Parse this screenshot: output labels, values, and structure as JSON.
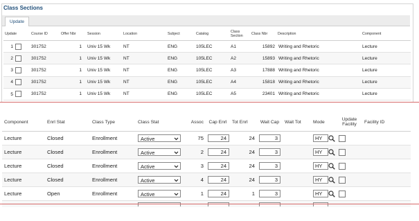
{
  "title": "Class Sections",
  "tab_label": "Update",
  "top_table": {
    "headers": [
      "Update",
      "Course ID",
      "Offer Nbr",
      "Session",
      "Location",
      "Subject",
      "Catalog",
      "Class Section",
      "Class Nbr",
      "Description",
      "Component"
    ],
    "rows": [
      {
        "n": "1",
        "course_id": "301752",
        "offer": "1",
        "session": "Univ 15 Wk",
        "location": "NT",
        "subject": "ENG",
        "catalog": "105LEC",
        "section": "A1",
        "class_nbr": "15892",
        "description": "Writing and Rhetoric",
        "component": "Lecture"
      },
      {
        "n": "2",
        "course_id": "301752",
        "offer": "1",
        "session": "Univ 15 Wk",
        "location": "NT",
        "subject": "ENG",
        "catalog": "105LEC",
        "section": "A2",
        "class_nbr": "15893",
        "description": "Writing and Rhetoric",
        "component": "Lecture"
      },
      {
        "n": "3",
        "course_id": "301752",
        "offer": "1",
        "session": "Univ 15 Wk",
        "location": "NT",
        "subject": "ENG",
        "catalog": "105LEC",
        "section": "A3",
        "class_nbr": "17888",
        "description": "Writing and Rhetoric",
        "component": "Lecture"
      },
      {
        "n": "4",
        "course_id": "301752",
        "offer": "1",
        "session": "Univ 15 Wk",
        "location": "NT",
        "subject": "ENG",
        "catalog": "105LEC",
        "section": "A4",
        "class_nbr": "15818",
        "description": "Writing and Rhetoric",
        "component": "Lecture"
      },
      {
        "n": "5",
        "course_id": "301752",
        "offer": "1",
        "session": "Univ 15 Wk",
        "location": "NT",
        "subject": "ENG",
        "catalog": "105LEC",
        "section": "A5",
        "class_nbr": "23401",
        "description": "Writing and Rhetoric",
        "component": "Lecture"
      }
    ]
  },
  "bottom_table": {
    "headers": [
      "Component",
      "Enrl Stat",
      "Class Type",
      "Class Stat",
      "Assoc",
      "Cap Enrl",
      "Tot Enrl",
      "Wait Cap",
      "Wait Tot",
      "Mode",
      "Update Facility",
      "Facility ID"
    ],
    "rows": [
      {
        "component": "Lecture",
        "enrl_stat": "Closed",
        "class_type": "Enrollment",
        "class_stat": "Active",
        "assoc": "75",
        "cap_enrl": "24",
        "tot_enrl": "24",
        "wait_cap": "3",
        "wait_tot": "",
        "mode": "HY",
        "facility_id": ""
      },
      {
        "component": "Lecture",
        "enrl_stat": "Closed",
        "class_type": "Enrollment",
        "class_stat": "Active",
        "assoc": "2",
        "cap_enrl": "24",
        "tot_enrl": "24",
        "wait_cap": "3",
        "wait_tot": "",
        "mode": "HY",
        "facility_id": ""
      },
      {
        "component": "Lecture",
        "enrl_stat": "Closed",
        "class_type": "Enrollment",
        "class_stat": "Active",
        "assoc": "3",
        "cap_enrl": "24",
        "tot_enrl": "24",
        "wait_cap": "3",
        "wait_tot": "",
        "mode": "HY",
        "facility_id": ""
      },
      {
        "component": "Lecture",
        "enrl_stat": "Closed",
        "class_type": "Enrollment",
        "class_stat": "Active",
        "assoc": "4",
        "cap_enrl": "24",
        "tot_enrl": "24",
        "wait_cap": "3",
        "wait_tot": "",
        "mode": "HY",
        "facility_id": ""
      },
      {
        "component": "Lecture",
        "enrl_stat": "Open",
        "class_type": "Enrollment",
        "class_stat": "Active",
        "assoc": "1",
        "cap_enrl": "24",
        "tot_enrl": "1",
        "wait_cap": "3",
        "wait_tot": "",
        "mode": "HY",
        "facility_id": ""
      }
    ]
  },
  "colors": {
    "title": "#1f4e79",
    "divider": "#d66a6a"
  }
}
